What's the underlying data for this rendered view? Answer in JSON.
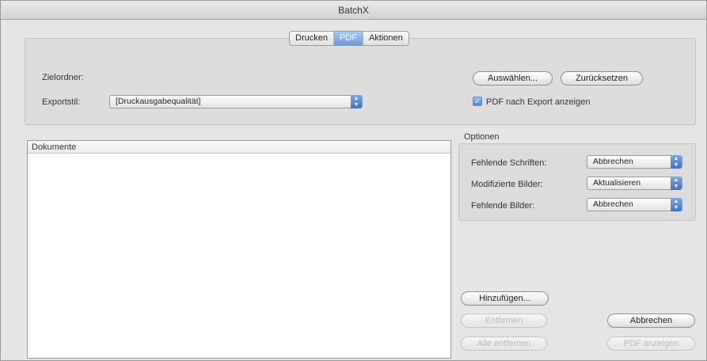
{
  "window": {
    "title": "BatchX"
  },
  "tabs": [
    {
      "label": "Drucken",
      "active": false
    },
    {
      "label": "PDF",
      "active": true
    },
    {
      "label": "Aktionen",
      "active": false
    }
  ],
  "export": {
    "target_folder_label": "Zielordner:",
    "style_label": "Exportstil:",
    "style_value": "[Druckausgabequalität]",
    "choose_button": "Auswählen...",
    "reset_button": "Zurücksetzen",
    "show_pdf_after_export_label": "PDF nach Export anzeigen",
    "show_pdf_after_export_checked": true
  },
  "documents": {
    "header": "Dokumente",
    "items": []
  },
  "options": {
    "title": "Optionen",
    "rows": [
      {
        "label": "Fehlende Schriften:",
        "value": "Abbrechen"
      },
      {
        "label": "Modifizierte Bilder:",
        "value": "Aktualisieren"
      },
      {
        "label": "Fehlende Bilder:",
        "value": "Abbrechen"
      }
    ]
  },
  "buttons": {
    "add": "Hinzufügen...",
    "remove": "Entfernen",
    "remove_all": "Alle entfernen",
    "cancel": "Abbrechen",
    "show_pdf": "PDF anzeigen"
  },
  "icons": {
    "select_arrows": "up-down-arrows-icon",
    "checkmark": "checkmark-icon"
  },
  "colors": {
    "accent": "#5b8ad6",
    "window_bg": "#e6e6e6"
  }
}
